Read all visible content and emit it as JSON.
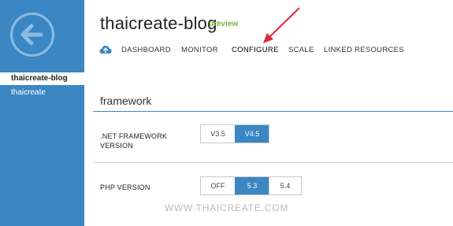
{
  "sidebar": {
    "items": [
      {
        "label": "thaicreate-blog"
      },
      {
        "label": "thaicreate"
      }
    ]
  },
  "header": {
    "title": "thaicreate-blog",
    "badge": "preview"
  },
  "nav": {
    "tabs": [
      {
        "label": "DASHBOARD"
      },
      {
        "label": "MONITOR"
      },
      {
        "label": "CONFIGURE"
      },
      {
        "label": "SCALE"
      },
      {
        "label": "LINKED RESOURCES"
      }
    ],
    "active": "CONFIGURE"
  },
  "section": {
    "title": "framework"
  },
  "settings": {
    "net_framework": {
      "label_line1": ".NET FRAMEWORK",
      "label_line2": "VERSION",
      "options": [
        "V3.5",
        "V4.5"
      ],
      "selected": "V4.5"
    },
    "php": {
      "label": "PHP VERSION",
      "options": [
        "OFF",
        "5.3",
        "5.4"
      ],
      "selected": "5.3"
    }
  },
  "watermark": "WWW.THAICREATE.COM",
  "colors": {
    "accent": "#3a87c4",
    "preview_green": "#7cb342",
    "annotation_arrow": "#e0283a"
  },
  "icons": {
    "back": "back-arrow-icon",
    "cloud": "cloud-upload-icon"
  }
}
